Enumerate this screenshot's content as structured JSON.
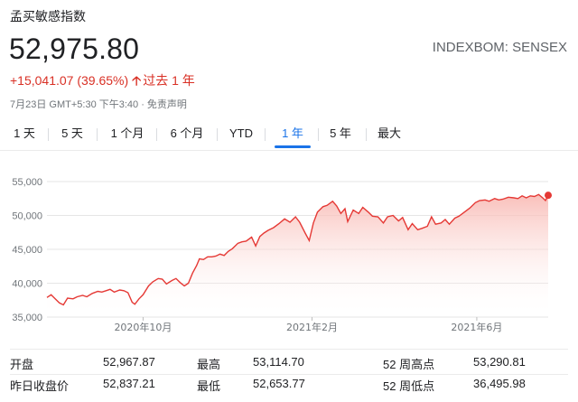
{
  "header": {
    "index_name": "孟买敏感指数",
    "price": "52,975.80",
    "ticker": "INDEXBOM: SENSEX",
    "change_text": "+15,041.07 (39.65%)",
    "change_arrow": "🡡",
    "change_period": "过去 1 年",
    "timestamp": "7月23日 GMT+5:30 下午3:40 · 免责声明"
  },
  "tabs": [
    {
      "label": "1 天",
      "active": false
    },
    {
      "label": "5 天",
      "active": false
    },
    {
      "label": "1 个月",
      "active": false
    },
    {
      "label": "6 个月",
      "active": false
    },
    {
      "label": "YTD",
      "active": false
    },
    {
      "label": "1 年",
      "active": true
    },
    {
      "label": "5 年",
      "active": false
    },
    {
      "label": "最大",
      "active": false
    }
  ],
  "colors": {
    "line": "#e53935",
    "fill_top": "#f8b4ae",
    "negative": "#d93025",
    "active_tab": "#1a73e8"
  },
  "chart_data": {
    "type": "area",
    "x_start": "2020-07-23",
    "x_end": "2021-07-23",
    "y_ticks": [
      35000,
      40000,
      45000,
      50000,
      55000
    ],
    "y_tick_labels": [
      "35,000",
      "40,000",
      "45,000",
      "50,000",
      "55,000"
    ],
    "ylim": [
      35000,
      55000
    ],
    "x_ticks": [
      {
        "label": "2020年10月",
        "date": "2020-10-01"
      },
      {
        "label": "2021年2月",
        "date": "2021-02-01"
      },
      {
        "label": "2021年6月",
        "date": "2021-06-01"
      }
    ],
    "grid": true,
    "series": [
      {
        "points": [
          [
            "2020-07-23",
            37900
          ],
          [
            "2020-07-26",
            38300
          ],
          [
            "2020-07-29",
            37700
          ],
          [
            "2020-08-01",
            37100
          ],
          [
            "2020-08-04",
            36800
          ],
          [
            "2020-08-07",
            37800
          ],
          [
            "2020-08-11",
            37700
          ],
          [
            "2020-08-14",
            38000
          ],
          [
            "2020-08-18",
            38200
          ],
          [
            "2020-08-21",
            38000
          ],
          [
            "2020-08-25",
            38500
          ],
          [
            "2020-08-29",
            38800
          ],
          [
            "2020-09-01",
            38700
          ],
          [
            "2020-09-04",
            38900
          ],
          [
            "2020-09-07",
            39100
          ],
          [
            "2020-09-10",
            38700
          ],
          [
            "2020-09-14",
            39000
          ],
          [
            "2020-09-17",
            38900
          ],
          [
            "2020-09-20",
            38600
          ],
          [
            "2020-09-23",
            37200
          ],
          [
            "2020-09-25",
            36900
          ],
          [
            "2020-09-28",
            37700
          ],
          [
            "2020-10-01",
            38300
          ],
          [
            "2020-10-05",
            39600
          ],
          [
            "2020-10-08",
            40200
          ],
          [
            "2020-10-12",
            40700
          ],
          [
            "2020-10-15",
            40600
          ],
          [
            "2020-10-18",
            39900
          ],
          [
            "2020-10-22",
            40400
          ],
          [
            "2020-10-25",
            40700
          ],
          [
            "2020-10-28",
            40100
          ],
          [
            "2020-10-31",
            39600
          ],
          [
            "2020-11-03",
            40000
          ],
          [
            "2020-11-06",
            41500
          ],
          [
            "2020-11-09",
            42600
          ],
          [
            "2020-11-11",
            43600
          ],
          [
            "2020-11-14",
            43500
          ],
          [
            "2020-11-17",
            43900
          ],
          [
            "2020-11-20",
            43900
          ],
          [
            "2020-11-23",
            44000
          ],
          [
            "2020-11-26",
            44300
          ],
          [
            "2020-11-29",
            44100
          ],
          [
            "2020-12-02",
            44700
          ],
          [
            "2020-12-05",
            45100
          ],
          [
            "2020-12-09",
            45900
          ],
          [
            "2020-12-12",
            46100
          ],
          [
            "2020-12-15",
            46200
          ],
          [
            "2020-12-19",
            46800
          ],
          [
            "2020-12-22",
            45500
          ],
          [
            "2020-12-25",
            46900
          ],
          [
            "2020-12-28",
            47400
          ],
          [
            "2020-12-31",
            47800
          ],
          [
            "2021-01-04",
            48200
          ],
          [
            "2021-01-08",
            48800
          ],
          [
            "2021-01-12",
            49500
          ],
          [
            "2021-01-16",
            49000
          ],
          [
            "2021-01-20",
            49800
          ],
          [
            "2021-01-23",
            49000
          ],
          [
            "2021-01-27",
            47400
          ],
          [
            "2021-01-30",
            46300
          ],
          [
            "2021-02-02",
            48900
          ],
          [
            "2021-02-05",
            50500
          ],
          [
            "2021-02-09",
            51300
          ],
          [
            "2021-02-12",
            51500
          ],
          [
            "2021-02-16",
            52100
          ],
          [
            "2021-02-19",
            51400
          ],
          [
            "2021-02-22",
            50300
          ],
          [
            "2021-02-25",
            51000
          ],
          [
            "2021-02-27",
            49100
          ],
          [
            "2021-03-03",
            50800
          ],
          [
            "2021-03-07",
            50300
          ],
          [
            "2021-03-10",
            51200
          ],
          [
            "2021-03-14",
            50500
          ],
          [
            "2021-03-17",
            49900
          ],
          [
            "2021-03-21",
            49800
          ],
          [
            "2021-03-25",
            48900
          ],
          [
            "2021-03-28",
            49800
          ],
          [
            "2021-04-01",
            50000
          ],
          [
            "2021-04-05",
            49200
          ],
          [
            "2021-04-08",
            49700
          ],
          [
            "2021-04-12",
            47900
          ],
          [
            "2021-04-15",
            48800
          ],
          [
            "2021-04-19",
            47900
          ],
          [
            "2021-04-22",
            48100
          ],
          [
            "2021-04-26",
            48400
          ],
          [
            "2021-04-29",
            49800
          ],
          [
            "2021-05-02",
            48700
          ],
          [
            "2021-05-06",
            48900
          ],
          [
            "2021-05-09",
            49400
          ],
          [
            "2021-05-12",
            48700
          ],
          [
            "2021-05-16",
            49600
          ],
          [
            "2021-05-19",
            49900
          ],
          [
            "2021-05-23",
            50500
          ],
          [
            "2021-05-27",
            51100
          ],
          [
            "2021-05-31",
            51900
          ],
          [
            "2021-06-03",
            52200
          ],
          [
            "2021-06-07",
            52300
          ],
          [
            "2021-06-10",
            52100
          ],
          [
            "2021-06-14",
            52500
          ],
          [
            "2021-06-17",
            52300
          ],
          [
            "2021-06-20",
            52400
          ],
          [
            "2021-06-24",
            52700
          ],
          [
            "2021-06-28",
            52600
          ],
          [
            "2021-07-01",
            52500
          ],
          [
            "2021-07-04",
            52900
          ],
          [
            "2021-07-07",
            52600
          ],
          [
            "2021-07-10",
            52900
          ],
          [
            "2021-07-13",
            52800
          ],
          [
            "2021-07-16",
            53100
          ],
          [
            "2021-07-19",
            52600
          ],
          [
            "2021-07-21",
            52200
          ],
          [
            "2021-07-23",
            52976
          ]
        ]
      }
    ]
  },
  "stats": {
    "open_label": "开盘",
    "open_value": "52,967.87",
    "prev_close_label": "昨日收盘价",
    "prev_close_value": "52,837.21",
    "high_label": "最高",
    "high_value": "53,114.70",
    "low_label": "最低",
    "low_value": "52,653.77",
    "wk52_high_label": "52 周高点",
    "wk52_high_value": "53,290.81",
    "wk52_low_label": "52 周低点",
    "wk52_low_value": "36,495.98"
  }
}
